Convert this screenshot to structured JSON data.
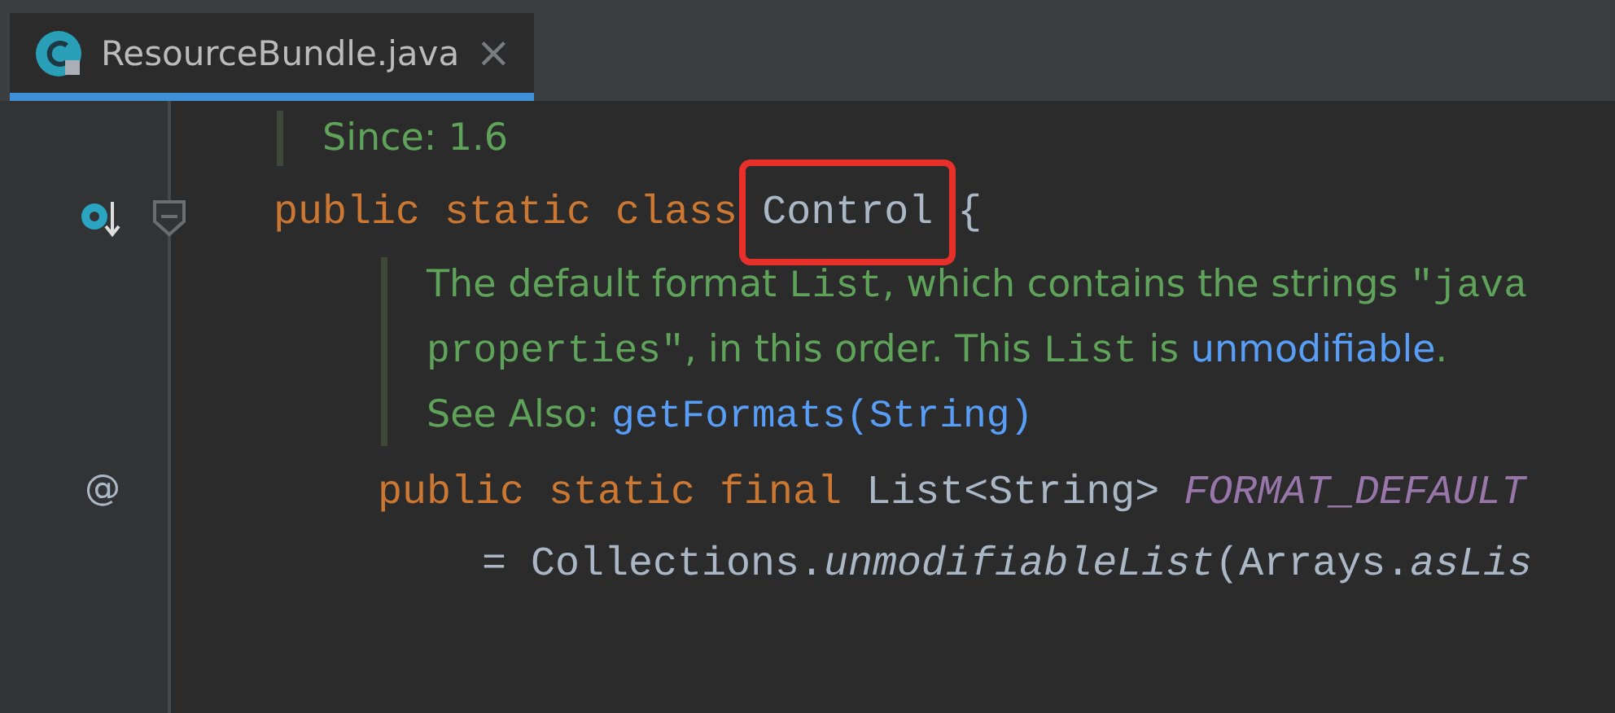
{
  "tab": {
    "title": "ResourceBundle.java",
    "close": "×",
    "selected": true
  },
  "code": [
    {
      "kind": "doc",
      "paragraphs": [
        [
          {
            "kind": "text",
            "text": "Since: 1.6"
          }
        ]
      ]
    },
    {
      "kind": "line",
      "implemented": true,
      "foldable": true,
      "tokens": [
        {
          "kind": "keyword",
          "text": "public static class "
        },
        {
          "kind": "boxed",
          "text": "Control"
        },
        {
          "kind": "plain",
          "text": " {"
        }
      ],
      "children": [
        {
          "kind": "doc",
          "paragraphs": [
            [
              {
                "kind": "text",
                "text": "The default format "
              },
              {
                "kind": "code",
                "text": "List"
              },
              {
                "kind": "text",
                "text": ", which contains the strings "
              },
              {
                "kind": "code",
                "text": "\"java"
              }
            ],
            [
              {
                "kind": "code",
                "text": "properties\""
              },
              {
                "kind": "text",
                "text": ", in this order. This "
              },
              {
                "kind": "code",
                "text": "List"
              },
              {
                "kind": "text",
                "text": " is "
              },
              {
                "kind": "link",
                "text": "unmodifiable"
              },
              {
                "kind": "text",
                "text": "."
              }
            ],
            [
              {
                "kind": "text",
                "text": "See Also: "
              },
              {
                "kind": "link",
                "text": "getFormats(String)"
              }
            ]
          ]
        },
        {
          "kind": "line",
          "gutter_mark": "@",
          "tokens": [
            {
              "kind": "keyword",
              "text": "public static final "
            },
            {
              "kind": "plain",
              "text": "List<String> "
            },
            {
              "kind": "field",
              "text": "FORMAT_DEFAULT"
            }
          ],
          "children": [
            {
              "kind": "line",
              "tokens": [
                {
                  "kind": "plain",
                  "text": "= Collections."
                },
                {
                  "kind": "method",
                  "text": "unmodifiableList"
                },
                {
                  "kind": "plain",
                  "text": "(Arrays."
                },
                {
                  "kind": "method",
                  "text": "asLis"
                }
              ]
            }
          ]
        }
      ]
    }
  ]
}
